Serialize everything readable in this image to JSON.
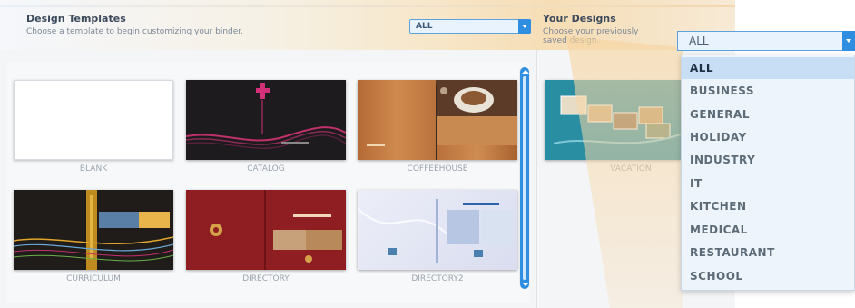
{
  "design_templates": {
    "title": "Design Templates",
    "subtitle": "Choose a template to begin customizing your binder.",
    "filter_value": "ALL"
  },
  "templates": [
    {
      "label": "BLANK"
    },
    {
      "label": "CATALOG"
    },
    {
      "label": "COFFEEHOUSE"
    },
    {
      "label": "CURRICULUM"
    },
    {
      "label": "DIRECTORY"
    },
    {
      "label": "DIRECTORY2"
    }
  ],
  "your_designs": {
    "title": "Your Designs",
    "subtitle_line1": "Choose your previously",
    "subtitle_line2": "saved design.",
    "items": [
      {
        "label": "VACATION"
      }
    ]
  },
  "category_dropdown": {
    "selected": "ALL",
    "options": [
      "ALL",
      "BUSINESS",
      "GENERAL",
      "HOLIDAY",
      "INDUSTRY",
      "IT",
      "KITCHEN",
      "MEDICAL",
      "RESTAURANT",
      "SCHOOL"
    ]
  },
  "colors": {
    "accent": "#2f8ee0",
    "header_warm": "#f6ddb5",
    "menu_selected": "#c7def4"
  }
}
